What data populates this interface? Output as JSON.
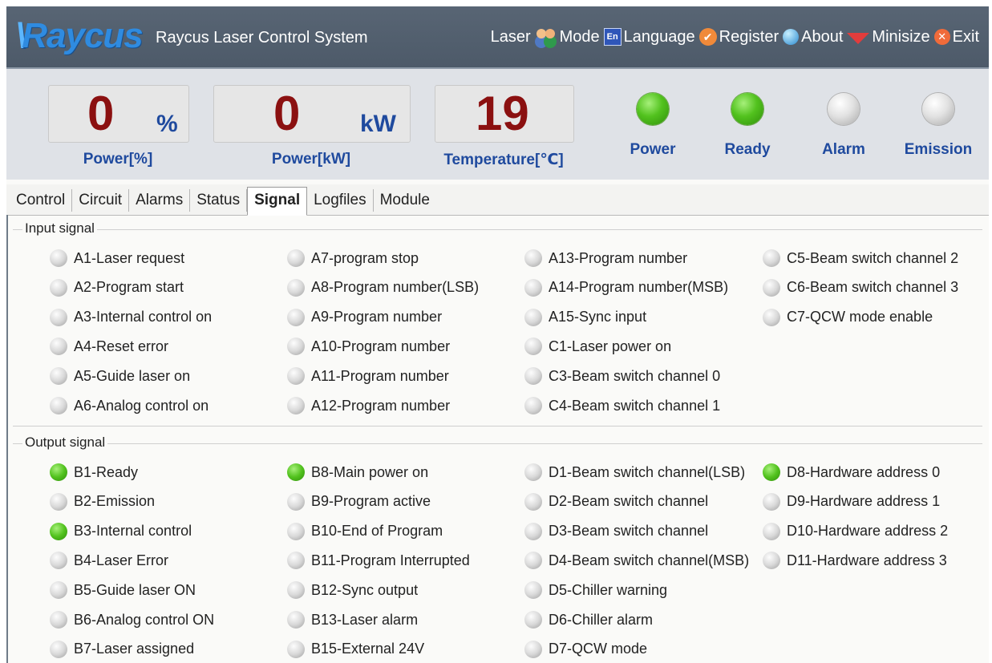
{
  "titlebar": {
    "logo": "Raycus",
    "title": "Raycus Laser Control System",
    "menu": {
      "laser": "Laser",
      "mode": "Mode",
      "language": "Language",
      "register": "Register",
      "about": "About",
      "minisize": "Minisize",
      "exit": "Exit"
    },
    "icons": [
      "users-icon",
      "en-flag-icon",
      "key-icon",
      "info-icon",
      "minimize-arrow-icon",
      "close-icon"
    ]
  },
  "readout": {
    "power_pct": {
      "value": "0",
      "unit": "%",
      "label": "Power[%]"
    },
    "power_kw": {
      "value": "0",
      "unit": "kW",
      "label": "Power[kW]"
    },
    "temperature": {
      "value": "19",
      "unit": "",
      "label": "Temperature[℃]"
    },
    "indicators": [
      {
        "label": "Power",
        "state": "on"
      },
      {
        "label": "Ready",
        "state": "on"
      },
      {
        "label": "Alarm",
        "state": "off"
      },
      {
        "label": "Emission",
        "state": "off"
      }
    ]
  },
  "tabs": [
    "Control",
    "Circuit",
    "Alarms",
    "Status",
    "Signal",
    "Logfiles",
    "Module"
  ],
  "active_tab": "Signal",
  "input_signal": {
    "title": "Input signal",
    "columns": [
      [
        {
          "label": "A1-Laser request",
          "state": "off"
        },
        {
          "label": "A2-Program start",
          "state": "off"
        },
        {
          "label": "A3-Internal control on",
          "state": "off"
        },
        {
          "label": "A4-Reset error",
          "state": "off"
        },
        {
          "label": "A5-Guide laser on",
          "state": "off"
        },
        {
          "label": "A6-Analog control on",
          "state": "off"
        }
      ],
      [
        {
          "label": "A7-program stop",
          "state": "off"
        },
        {
          "label": "A8-Program number(LSB)",
          "state": "off"
        },
        {
          "label": "A9-Program number",
          "state": "off"
        },
        {
          "label": "A10-Program number",
          "state": "off"
        },
        {
          "label": "A11-Program number",
          "state": "off"
        },
        {
          "label": "A12-Program number",
          "state": "off"
        }
      ],
      [
        {
          "label": "A13-Program number",
          "state": "off"
        },
        {
          "label": "A14-Program number(MSB)",
          "state": "off"
        },
        {
          "label": "A15-Sync input",
          "state": "off"
        },
        {
          "label": "C1-Laser power on",
          "state": "off"
        },
        {
          "label": "C3-Beam switch channel 0",
          "state": "off"
        },
        {
          "label": "C4-Beam switch channel 1",
          "state": "off"
        }
      ],
      [
        {
          "label": "C5-Beam switch channel 2",
          "state": "off"
        },
        {
          "label": "C6-Beam switch channel 3",
          "state": "off"
        },
        {
          "label": "C7-QCW mode enable",
          "state": "off"
        }
      ]
    ]
  },
  "output_signal": {
    "title": "Output signal",
    "columns": [
      [
        {
          "label": "B1-Ready",
          "state": "on"
        },
        {
          "label": "B2-Emission",
          "state": "off"
        },
        {
          "label": "B3-Internal control",
          "state": "on"
        },
        {
          "label": "B4-Laser Error",
          "state": "off"
        },
        {
          "label": "B5-Guide laser ON",
          "state": "off"
        },
        {
          "label": "B6-Analog control ON",
          "state": "off"
        },
        {
          "label": "B7-Laser assigned",
          "state": "off"
        }
      ],
      [
        {
          "label": "B8-Main power on",
          "state": "on"
        },
        {
          "label": "B9-Program active",
          "state": "off"
        },
        {
          "label": "B10-End of Program",
          "state": "off"
        },
        {
          "label": "B11-Program Interrupted",
          "state": "off"
        },
        {
          "label": "B12-Sync output",
          "state": "off"
        },
        {
          "label": "B13-Laser alarm",
          "state": "off"
        },
        {
          "label": "B15-External 24V",
          "state": "off"
        }
      ],
      [
        {
          "label": "D1-Beam switch channel(LSB)",
          "state": "off"
        },
        {
          "label": "D2-Beam switch channel",
          "state": "off"
        },
        {
          "label": "D3-Beam switch channel",
          "state": "off"
        },
        {
          "label": "D4-Beam switch channel(MSB)",
          "state": "off"
        },
        {
          "label": "D5-Chiller warning",
          "state": "off"
        },
        {
          "label": "D6-Chiller alarm",
          "state": "off"
        },
        {
          "label": "D7-QCW mode",
          "state": "off"
        }
      ],
      [
        {
          "label": "D8-Hardware address 0",
          "state": "on"
        },
        {
          "label": "D9-Hardware address 1",
          "state": "off"
        },
        {
          "label": "D10-Hardware address 2",
          "state": "off"
        },
        {
          "label": "D11-Hardware address 3",
          "state": "off"
        }
      ]
    ]
  }
}
